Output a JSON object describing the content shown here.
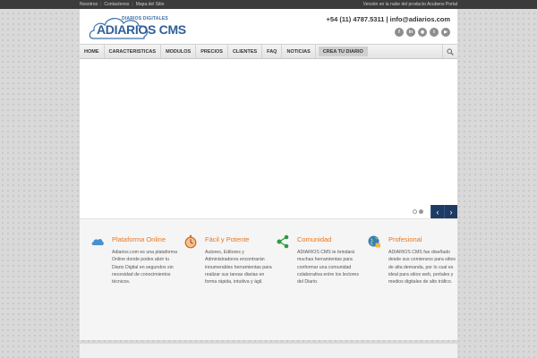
{
  "topbar": {
    "links": [
      "Nosotros",
      "Contactenos",
      "Mapa del Sitio"
    ],
    "right_text": "Versión en la nube del producto Acubens Portal"
  },
  "header": {
    "logo_tagline": "DIARIOS DIGITALES",
    "logo_name": "ADIARIOS CMS",
    "contact": "+54 (11) 4787.5311 | info@adiarios.com",
    "socials": [
      {
        "icon": "facebook-icon",
        "glyph": "f"
      },
      {
        "icon": "linkedin-icon",
        "glyph": "in"
      },
      {
        "icon": "rss-icon",
        "glyph": "◉"
      },
      {
        "icon": "twitter-icon",
        "glyph": "t"
      },
      {
        "icon": "youtube-icon",
        "glyph": "▶"
      }
    ]
  },
  "nav": {
    "items": [
      "HOME",
      "CARACTERISTICAS",
      "MODULOS",
      "PRECIOS",
      "CLIENTES",
      "FAQ",
      "NOTICIAS"
    ],
    "cta": "CREA TU DIARIO"
  },
  "slider": {
    "slide_count": 2,
    "active_slide": 2,
    "prev": "‹",
    "next": "›"
  },
  "features": [
    {
      "icon": "cloud-icon",
      "title": "Plataforma Online",
      "text": "Adiarios.com es una plataforma Online donde podes abrir tu Diario Digital en segundos sin necesidad de conocimientos técnicos."
    },
    {
      "icon": "stopwatch-icon",
      "title": "Fácil y Potente",
      "text": "Autores, Editores y Administradores encontrarán innumerables herramientas para realizar sus tareas diarias en forma rápida, intuitiva y ágil."
    },
    {
      "icon": "share-icon",
      "title": "Comunidad",
      "text": "ADIARIOS CMS te brindará muchas herramientas para conformar una comunidad colaborativa entre los lectores del Diario."
    },
    {
      "icon": "globe-icon",
      "title": "Profesional",
      "text": "ADIARIOS CMS fue diseñado desde sus comienzos para sitios de alta demanda, por lo cual es ideal para sitios web, portales y medios digitales de alto tráfico."
    }
  ],
  "colors": {
    "accent_orange": "#e8761e",
    "brand_blue": "#2f5f99",
    "slider_nav": "#1e3b63"
  }
}
